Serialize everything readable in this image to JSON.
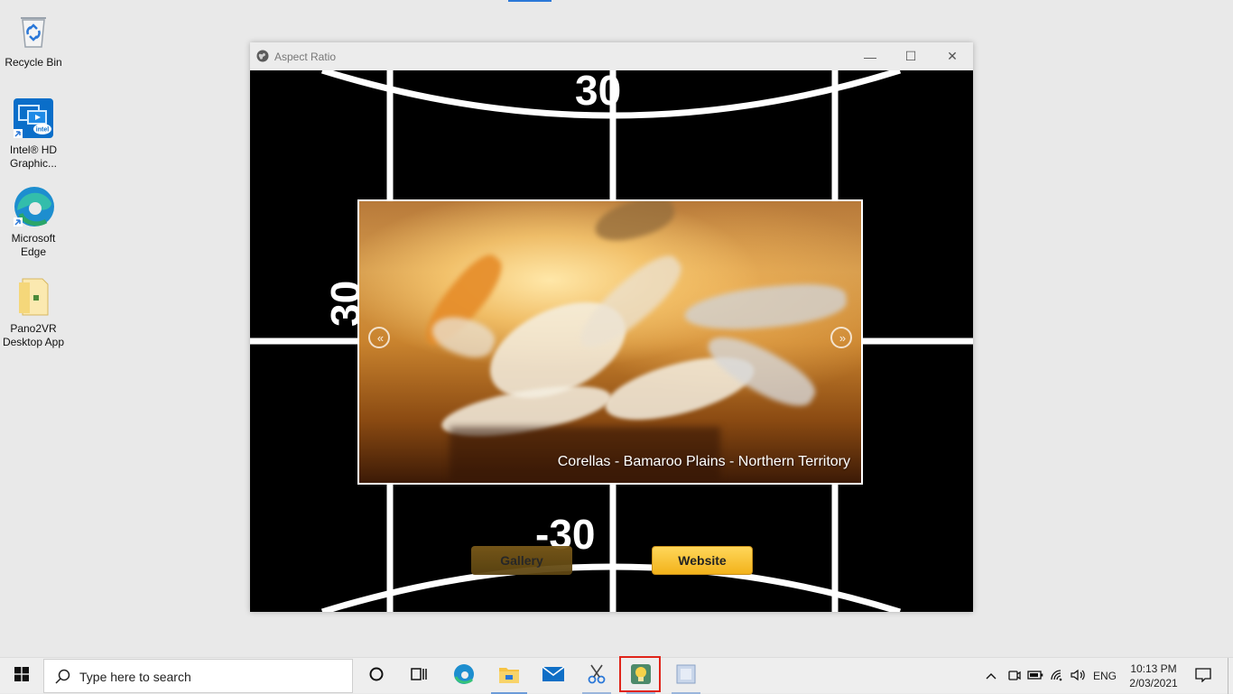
{
  "desktop": {
    "icons": [
      {
        "label": "Recycle Bin",
        "icon": "recycle-bin-icon"
      },
      {
        "label": "Intel® HD Graphic...",
        "icon": "intel-graphics-icon"
      },
      {
        "label": "Microsoft Edge",
        "icon": "edge-icon"
      },
      {
        "label": "Pano2VR Desktop App",
        "icon": "folder-icon"
      }
    ]
  },
  "window": {
    "title": "Aspect Ratio",
    "minimize": "—",
    "maximize": "☐",
    "close": "✕",
    "grid_labels": {
      "top": "30",
      "left": "30",
      "bottom": "-30"
    },
    "popup": {
      "caption": "Corellas - Bamaroo Plains - Northern Territory",
      "prev": "«",
      "next": "»"
    },
    "buttons": {
      "gallery": "Gallery",
      "website": "Website"
    }
  },
  "taskbar": {
    "search_placeholder": "Type here to search",
    "language": "ENG",
    "time": "10:13 PM",
    "date": "2/03/2021"
  },
  "colors": {
    "accent": "#2b78d8",
    "highlight": "#e0241a",
    "website_button": "#f2b21b",
    "gallery_button": "#6a4f16"
  }
}
